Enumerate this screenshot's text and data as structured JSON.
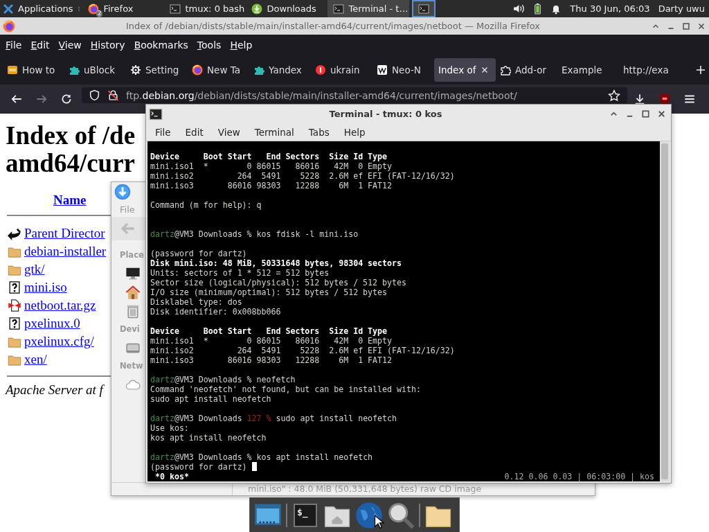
{
  "top_panel": {
    "launcher": {
      "label": "Applications"
    },
    "tasks": [
      {
        "label": "Firefox",
        "kind": "firefox",
        "badge": "2",
        "selected": false
      },
      {
        "label": "tmux: 0 bash",
        "kind": "terminal",
        "selected": false
      },
      {
        "label": "Downloads",
        "kind": "download",
        "selected": false
      },
      {
        "label": "Terminal - t…",
        "kind": "terminal",
        "selected": true
      },
      {
        "kind": "terminal",
        "selected": true
      }
    ],
    "clock": "Thu 30 Jun, 06:03",
    "user": "Darty uwu"
  },
  "firefox": {
    "title": "Index of /debian/dists/stable/main/installer-amd64/current/images/netboot — Mozilla Firefox",
    "menu": [
      "File",
      "Edit",
      "View",
      "History",
      "Bookmarks",
      "Tools",
      "Help"
    ],
    "tabs": [
      {
        "label": "How to",
        "kind": "square",
        "selected": false
      },
      {
        "label": "uBlock",
        "kind": "puzzle",
        "selected": false
      },
      {
        "label": "Setting",
        "kind": "gear",
        "selected": false
      },
      {
        "label": "New Ta",
        "kind": "firefox",
        "selected": false
      },
      {
        "label": "Yandex",
        "kind": "puzzle",
        "selected": false
      },
      {
        "label": "ukrain",
        "kind": "circle",
        "selected": false
      },
      {
        "label": "Neo-N",
        "kind": "wiki",
        "selected": false
      },
      {
        "label": "Index of",
        "kind": "plain",
        "selected": true
      },
      {
        "label": "Add-or",
        "kind": "addon",
        "selected": false
      },
      {
        "label": "Example",
        "kind": "plain",
        "selected": false
      },
      {
        "label": "http://exa",
        "kind": "plain",
        "selected": false
      }
    ],
    "url": {
      "prefix": "ftp.",
      "domain": "debian.org",
      "path": "/debian/dists/stable/main/installer-amd64/current/images/netboot/"
    },
    "page": {
      "heading_lines": [
        "Index of /de",
        "amd64/curr"
      ],
      "column_header": "Name",
      "entries": [
        {
          "name": "Parent Director",
          "kind": "parent"
        },
        {
          "name": "debian-installer",
          "kind": "folder"
        },
        {
          "name": "gtk/",
          "kind": "folder"
        },
        {
          "name": "mini.iso",
          "kind": "unknown"
        },
        {
          "name": "netboot.tar.gz",
          "kind": "archive"
        },
        {
          "name": "pxelinux.0",
          "kind": "unknown"
        },
        {
          "name": "pxelinux.cfg/",
          "kind": "folder"
        },
        {
          "name": "xen/",
          "kind": "folder"
        }
      ],
      "footer": "Apache Server at f"
    }
  },
  "file_manager": {
    "menu": [
      "File"
    ],
    "sidebar": [
      {
        "kind": "heading",
        "label": "Place"
      },
      {
        "kind": "monitor"
      },
      {
        "kind": "home"
      },
      {
        "kind": "trash"
      },
      {
        "kind": "heading",
        "label": "Devi"
      },
      {
        "kind": "drive"
      },
      {
        "kind": "heading",
        "label": "Netw"
      },
      {
        "kind": "cloud"
      }
    ],
    "status": "mini.iso\" : 48.0 MiB (50,331,648 bytes) raw CD image"
  },
  "terminal": {
    "title": "Terminal - tmux: 0 kos",
    "menu": [
      "File",
      "Edit",
      "View",
      "Terminal",
      "Tabs",
      "Help"
    ],
    "lines": [
      {
        "kind": "bold",
        "text": "Device     Boot Start   End Sectors  Size Id Type"
      },
      {
        "kind": "plain",
        "text": "mini.iso1  *        0 86015   86016   42M  0 Empty"
      },
      {
        "kind": "plain",
        "text": "mini.iso2         264  5491    5228  2.6M ef EFI (FAT-12/16/32)"
      },
      {
        "kind": "plain",
        "text": "mini.iso3       86016 98303   12288    6M  1 FAT12"
      },
      {
        "kind": "blank"
      },
      {
        "kind": "plain",
        "text": "Command (m for help): q"
      },
      {
        "kind": "blank"
      },
      {
        "kind": "blank"
      },
      {
        "kind": "prompt",
        "user": "dartz",
        "host": "@VM3 Downloads",
        "status": "%",
        "error": false,
        "command": "kos fdisk -l mini.iso"
      },
      {
        "kind": "blank"
      },
      {
        "kind": "plain",
        "text": "(password for dartz)"
      },
      {
        "kind": "bold",
        "text": "Disk mini.iso: 48 MiB, 50331648 bytes, 98304 sectors"
      },
      {
        "kind": "plain",
        "text": "Units: sectors of 1 * 512 = 512 bytes"
      },
      {
        "kind": "plain",
        "text": "Sector size (logical/physical): 512 bytes / 512 bytes"
      },
      {
        "kind": "plain",
        "text": "I/O size (minimum/optimal): 512 bytes / 512 bytes"
      },
      {
        "kind": "plain",
        "text": "Disklabel type: dos"
      },
      {
        "kind": "plain",
        "text": "Disk identifier: 0x008bb066"
      },
      {
        "kind": "blank"
      },
      {
        "kind": "bold",
        "text": "Device     Boot Start   End Sectors  Size Id Type"
      },
      {
        "kind": "plain",
        "text": "mini.iso1  *        0 86015   86016   42M  0 Empty"
      },
      {
        "kind": "plain",
        "text": "mini.iso2         264  5491    5228  2.6M ef EFI (FAT-12/16/32)"
      },
      {
        "kind": "plain",
        "text": "mini.iso3       86016 98303   12288    6M  1 FAT12"
      },
      {
        "kind": "blank"
      },
      {
        "kind": "prompt",
        "user": "dartz",
        "host": "@VM3 Downloads",
        "status": "%",
        "error": false,
        "command": "neofetch"
      },
      {
        "kind": "plain",
        "text": "Command 'neofetch' not found, but can be installed with:"
      },
      {
        "kind": "plain",
        "text": "sudo apt install neofetch"
      },
      {
        "kind": "blank"
      },
      {
        "kind": "prompt",
        "user": "dartz",
        "host": "@VM3 Downloads",
        "status": "127 %",
        "error": true,
        "command": "sudo apt install neofetch"
      },
      {
        "kind": "plain",
        "text": "Use kos:"
      },
      {
        "kind": "plain",
        "text": "kos apt install neofetch"
      },
      {
        "kind": "blank"
      },
      {
        "kind": "prompt",
        "user": "dartz",
        "host": "@VM3 Downloads",
        "status": "%",
        "error": false,
        "command": "kos apt install neofetch"
      },
      {
        "kind": "input",
        "text": "(password for dartz)"
      }
    ],
    "status_left": "*0 kos*",
    "status_right": "0.12 0.06 0.03 | 06:03:00 | kos"
  },
  "dock": {
    "items": [
      {
        "kind": "desktop"
      },
      {
        "kind": "separator"
      },
      {
        "kind": "terminal",
        "glyph": "$_"
      },
      {
        "kind": "home"
      },
      {
        "kind": "browser"
      },
      {
        "kind": "search"
      },
      {
        "kind": "separator"
      },
      {
        "kind": "folder"
      }
    ]
  }
}
